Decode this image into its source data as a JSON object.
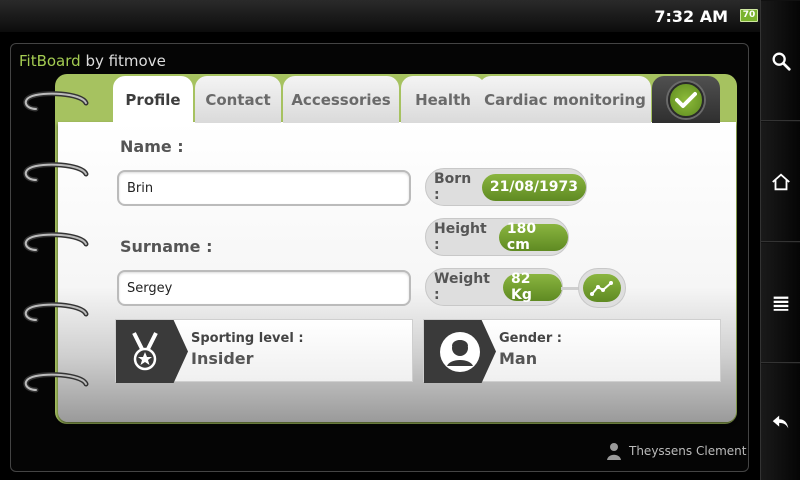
{
  "status": {
    "time": "7:32 AM",
    "battery": "70"
  },
  "app": {
    "brand": "FitBoard",
    "suffix": " by fitmove"
  },
  "tabs": [
    {
      "label": "Profile",
      "active": true
    },
    {
      "label": "Contact"
    },
    {
      "label": "Accessories"
    },
    {
      "label": "Health"
    },
    {
      "label": "Cardiac monitoring"
    }
  ],
  "form": {
    "name_label": "Name :",
    "name_value": "Brin",
    "surname_label": "Surname :",
    "surname_value": "Sergey",
    "born_label": "Born :",
    "born_value": "21/08/1973",
    "height_label": "Height :",
    "height_value": "180 cm",
    "weight_label": "Weight :",
    "weight_value": "82 Kg"
  },
  "cards": {
    "sporting_label": "Sporting level :",
    "sporting_value": "Insider",
    "gender_label": "Gender :",
    "gender_value": "Man"
  },
  "user": {
    "name": "Theyssens Clement"
  },
  "icons": {
    "sys": [
      "search-icon",
      "home-icon",
      "menu-icon",
      "back-icon"
    ],
    "check": "check-icon",
    "trend": "chart-trend-icon",
    "medal": "medal-icon",
    "avatar": "person-avatar-icon"
  },
  "colors": {
    "accent": "#8ab540",
    "accent_dark": "#5f8a22",
    "notebook": "#a6c260"
  }
}
